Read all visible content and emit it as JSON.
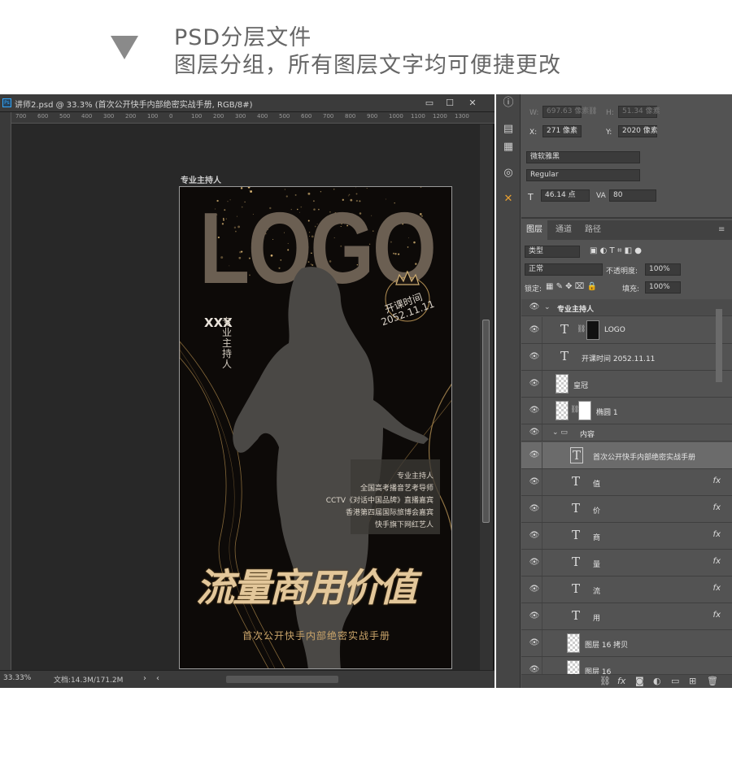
{
  "header": {
    "line1": "PSD分层文件",
    "line2": "图层分组，所有图层文字均可便捷更改"
  },
  "window": {
    "title": "讲师2.psd @ 33.3% (首次公开快手内部绝密实战手册, RGB/8#)",
    "app_icon": "Ps",
    "minimize": "▭",
    "restore": "☐",
    "close": "✕",
    "ruler_ticks": [
      "700",
      "600",
      "500",
      "400",
      "300",
      "200",
      "100",
      "0",
      "100",
      "200",
      "300",
      "400",
      "500",
      "600",
      "700",
      "800",
      "900",
      "1000",
      "1100",
      "1200",
      "1300"
    ],
    "zoom": "33.33%",
    "doc_info": "文档:14.3M/171.2M",
    "artboard_name": "专业主持人"
  },
  "poster": {
    "logo": "LOGO",
    "badge_line1": "开课时间",
    "badge_line2": "2052.11.11",
    "name": "XXX",
    "host": "专业主持人",
    "info": [
      "专业主持人",
      "全国高考播音艺考导师",
      "CCTV《对话中国品牌》直播嘉宾",
      "香港第四届国际旅博会嘉宾",
      "快手旗下网红艺人"
    ],
    "calligraphy": "流量商用价值",
    "subtitle": "首次公开快手内部绝密实战手册"
  },
  "props": {
    "w_label": "W:",
    "w_val": "697.63 像素",
    "h_label": "H:",
    "h_val": "51.34 像素",
    "x_label": "X:",
    "x_val": "271 像素",
    "y_label": "Y:",
    "y_val": "2020 像素",
    "font_family": "微软雅黑",
    "font_style": "Regular",
    "font_size": "46.14 点",
    "tracking": "80"
  },
  "layers_panel": {
    "tabs": [
      "图层",
      "通道",
      "路径"
    ],
    "filter": "类型",
    "blend": "正常",
    "opacity_label": "不透明度:",
    "opacity": "100%",
    "lock_label": "锁定:",
    "fill_label": "填充:",
    "fill": "100%",
    "group_name": "专业主持人",
    "layers": [
      {
        "name": "LOGO",
        "kind": "text-linked"
      },
      {
        "name": "开课时间 2052.11.11",
        "kind": "text"
      },
      {
        "name": "皇冠",
        "kind": "image"
      },
      {
        "name": "椭圆 1",
        "kind": "image-linked"
      },
      {
        "name": "内容",
        "kind": "folder"
      },
      {
        "name": "首次公开快手内部绝密实战手册",
        "kind": "text-selected"
      },
      {
        "name": "值",
        "kind": "text-fx"
      },
      {
        "name": "价",
        "kind": "text-fx"
      },
      {
        "name": "商",
        "kind": "text-fx"
      },
      {
        "name": "量",
        "kind": "text-fx"
      },
      {
        "name": "流",
        "kind": "text-fx"
      },
      {
        "name": "用",
        "kind": "text-fx"
      },
      {
        "name": "图层 16 拷贝",
        "kind": "image"
      },
      {
        "name": "图层 16",
        "kind": "image"
      }
    ],
    "fx_label": "fx",
    "footer_icons": [
      "link-icon",
      "fx-icon",
      "mask-icon",
      "adjust-icon",
      "folder-icon",
      "new-layer-icon",
      "trash-icon"
    ]
  }
}
